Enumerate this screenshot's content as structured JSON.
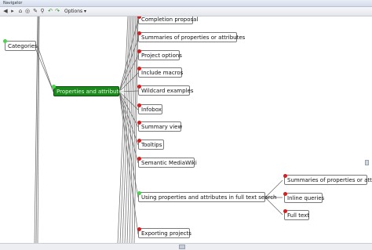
{
  "window": {
    "title": "Navigator"
  },
  "toolbar": {
    "options_label": "Options ▾"
  },
  "nodes": {
    "categories": "Categories",
    "properties": "Properties and attributes",
    "completion": "Completion proposal",
    "summaries": "Summaries of properties or attributes",
    "project_options": "Project options",
    "include_macros": "Include macros",
    "wildcard": "Wildcard examples",
    "infobox": "Infobox",
    "summary_view": "Summary view",
    "tooltips": "Tooltips",
    "semantic": "Semantic MediaWiki",
    "fulltext": "Using properties and attributes in full text search",
    "summaries_sub": "Summaries of properties or attrib",
    "inline_queries": "Inline queries",
    "full_text": "Full text",
    "exporting": "Exporting projects"
  },
  "colors": {
    "selected_node": "#1a8a1a",
    "leaf_dot": "#d62020",
    "expanded_dot": "#4ad44a"
  }
}
